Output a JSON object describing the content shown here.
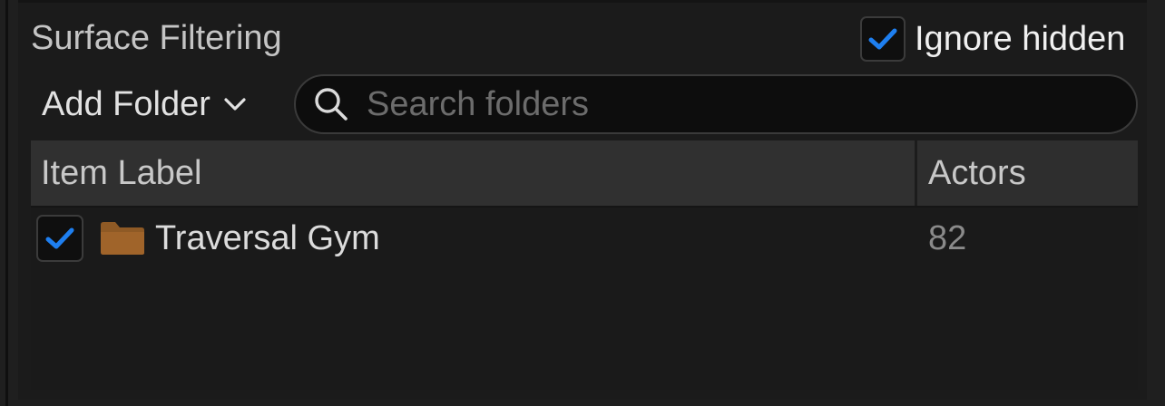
{
  "panel": {
    "section_title": "Surface Filtering",
    "ignore_hidden": {
      "label": "Ignore hidden",
      "checked": true
    }
  },
  "toolbar": {
    "add_folder_label": "Add Folder",
    "search_placeholder": "Search folders",
    "search_value": ""
  },
  "table": {
    "columns": [
      "Item Label",
      "Actors"
    ],
    "rows": [
      {
        "checked": true,
        "icon": "folder-icon",
        "label": "Traversal Gym",
        "actors": "82"
      }
    ]
  },
  "colors": {
    "accent_check": "#1e7ff0",
    "folder": "#a0642a",
    "panel_bg": "#1b1b1b",
    "header_bg": "#303030"
  }
}
